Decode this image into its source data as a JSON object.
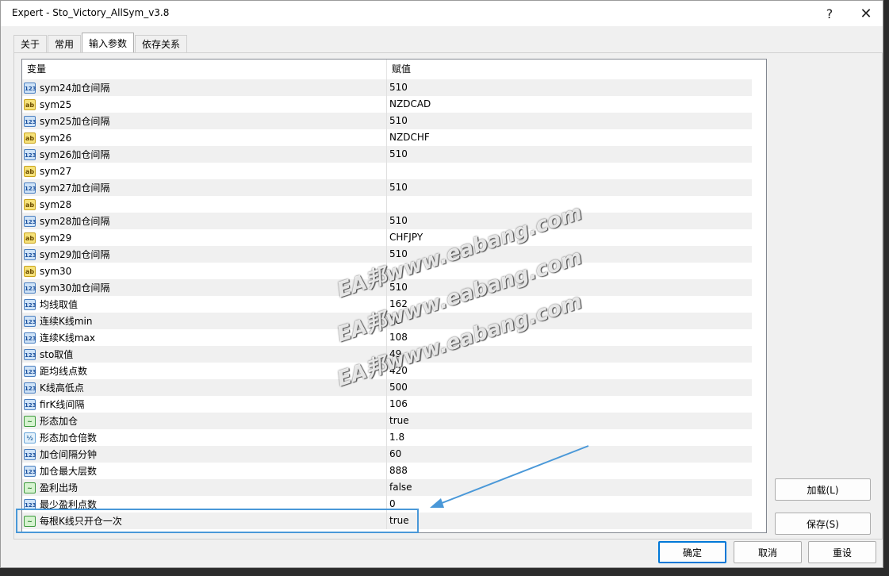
{
  "window": {
    "title": "Expert - Sto_Victory_AllSym_v3.8",
    "help_label": "?",
    "close_label": "✕"
  },
  "tabs": [
    {
      "label": "关于"
    },
    {
      "label": "常用"
    },
    {
      "label": "输入参数"
    },
    {
      "label": "依存关系"
    }
  ],
  "table": {
    "col_variable": "变量",
    "col_value": "赋值",
    "rows": [
      {
        "name": "sym24加仓间隔",
        "value": "510",
        "type": "int"
      },
      {
        "name": "sym25",
        "value": "NZDCAD",
        "type": "str"
      },
      {
        "name": "sym25加仓间隔",
        "value": "510",
        "type": "int"
      },
      {
        "name": "sym26",
        "value": "NZDCHF",
        "type": "str"
      },
      {
        "name": "sym26加仓间隔",
        "value": "510",
        "type": "int"
      },
      {
        "name": "sym27",
        "value": "",
        "type": "str"
      },
      {
        "name": "sym27加仓间隔",
        "value": "510",
        "type": "int"
      },
      {
        "name": "sym28",
        "value": "",
        "type": "str"
      },
      {
        "name": "sym28加仓间隔",
        "value": "510",
        "type": "int"
      },
      {
        "name": "sym29",
        "value": "CHFJPY",
        "type": "str"
      },
      {
        "name": "sym29加仓间隔",
        "value": "510",
        "type": "int"
      },
      {
        "name": "sym30",
        "value": "",
        "type": "str"
      },
      {
        "name": "sym30加仓间隔",
        "value": "510",
        "type": "int"
      },
      {
        "name": "均线取值",
        "value": "162",
        "type": "int"
      },
      {
        "name": "连续K线min",
        "value": "38",
        "type": "int"
      },
      {
        "name": "连续K线max",
        "value": "108",
        "type": "int"
      },
      {
        "name": "sto取值",
        "value": "49",
        "type": "int"
      },
      {
        "name": "距均线点数",
        "value": "420",
        "type": "int"
      },
      {
        "name": "K线高低点",
        "value": "500",
        "type": "int"
      },
      {
        "name": "firK线间隔",
        "value": "106",
        "type": "int"
      },
      {
        "name": "形态加仓",
        "value": "true",
        "type": "bool"
      },
      {
        "name": "形态加仓倍数",
        "value": "1.8",
        "type": "dbl"
      },
      {
        "name": "加仓间隔分钟",
        "value": "60",
        "type": "int"
      },
      {
        "name": "加仓最大层数",
        "value": "888",
        "type": "int"
      },
      {
        "name": "盈利出场",
        "value": "false",
        "type": "bool"
      },
      {
        "name": "最少盈利点数",
        "value": "0",
        "type": "int"
      },
      {
        "name": "每根K线只开仓一次",
        "value": "true",
        "type": "bool"
      }
    ]
  },
  "icons": {
    "int": "123",
    "str": "ab",
    "bool": "~",
    "dbl": "½"
  },
  "buttons": {
    "load": "加载(L)",
    "save": "保存(S)",
    "ok": "确定",
    "cancel": "取消",
    "reset": "重设"
  },
  "watermark": "EA邦www.eabang.com",
  "colors": {
    "accent": "#0078d7",
    "highlight": "#4a98d8"
  }
}
